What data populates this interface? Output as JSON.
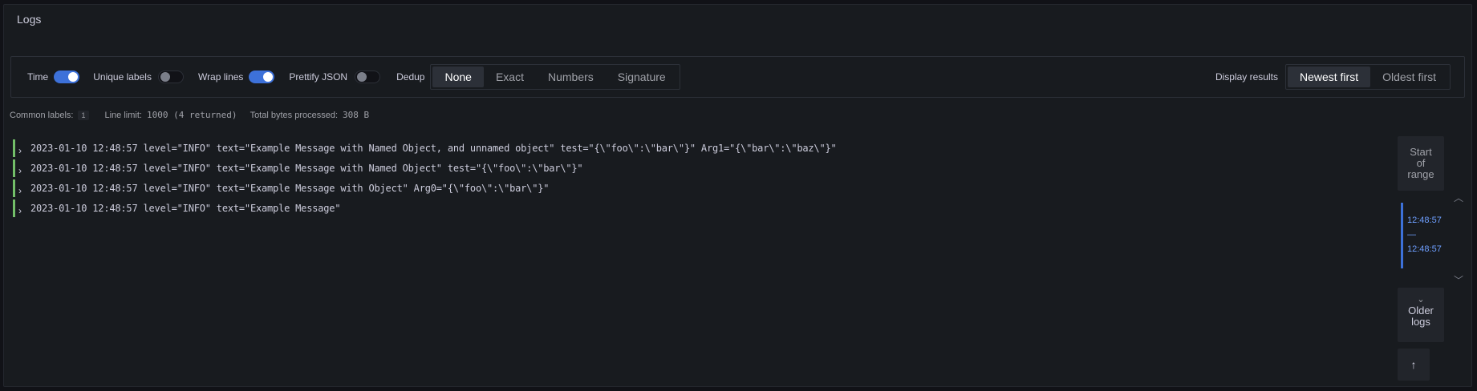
{
  "panel": {
    "title": "Logs"
  },
  "controls": {
    "time_label": "Time",
    "unique_labels_label": "Unique labels",
    "wrap_lines_label": "Wrap lines",
    "prettify_json_label": "Prettify JSON",
    "dedup_label": "Dedup",
    "dedup_options": [
      "None",
      "Exact",
      "Numbers",
      "Signature"
    ],
    "dedup_selected": "None",
    "display_results_label": "Display results",
    "order_options": [
      "Newest first",
      "Oldest first"
    ],
    "order_selected": "Newest first",
    "toggles": {
      "time": true,
      "unique_labels": false,
      "wrap_lines": true,
      "prettify_json": false
    }
  },
  "stats": {
    "common_labels_label": "Common labels:",
    "common_labels_count": "1",
    "line_limit_label": "Line limit:",
    "line_limit_value": "1000 (4 returned)",
    "bytes_label": "Total bytes processed:",
    "bytes_value": "308 B"
  },
  "logs": [
    {
      "text": "2023-01-10 12:48:57 level=\"INFO\" text=\"Example Message with Named Object, and unnamed object\" test=\"{\\\"foo\\\":\\\"bar\\\"}\" Arg1=\"{\\\"bar\\\":\\\"baz\\\"}\""
    },
    {
      "text": "2023-01-10 12:48:57 level=\"INFO\" text=\"Example Message with Named Object\" test=\"{\\\"foo\\\":\\\"bar\\\"}\""
    },
    {
      "text": "2023-01-10 12:48:57 level=\"INFO\" text=\"Example Message with Object\" Arg0=\"{\\\"foo\\\":\\\"bar\\\"}\""
    },
    {
      "text": "2023-01-10 12:48:57 level=\"INFO\" text=\"Example Message\""
    }
  ],
  "navigation": {
    "start_line1": "Start",
    "start_line2": "of",
    "start_line3": "range",
    "range_from": "12:48:57",
    "range_sep": "—",
    "range_to": "12:48:57",
    "older_line1": "Older",
    "older_line2": "logs"
  },
  "colors": {
    "accent": "#3d71d9",
    "log_level_info": "#73bf69",
    "range_text": "#6e9fff"
  }
}
